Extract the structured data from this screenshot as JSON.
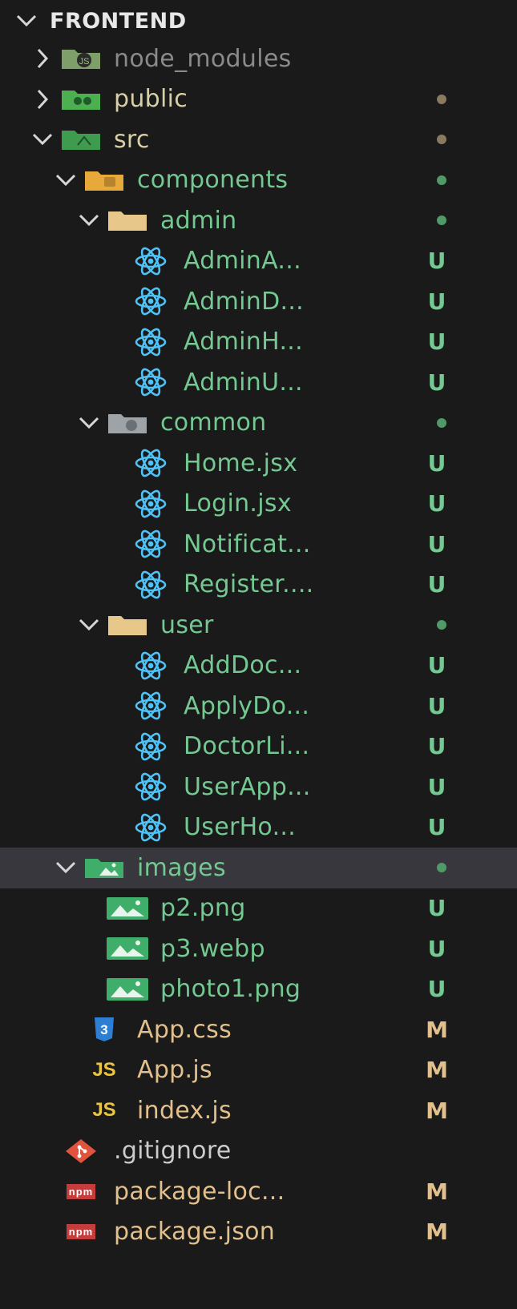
{
  "explorer": {
    "root": {
      "label": "FRONTEND"
    },
    "items": [
      {
        "label": "node_modules",
        "type": "folder",
        "icon": "js-folder-icon",
        "chevron": "right",
        "badge": "",
        "dot": "",
        "color": "#8a8a8a",
        "iconColor": "#7e9e6a",
        "depth": 1
      },
      {
        "label": "public",
        "type": "folder",
        "icon": "public-folder-icon",
        "chevron": "right",
        "badge": "",
        "dot": "#8a7a60",
        "color": "#d8cfa6",
        "iconColor": "#4caf50",
        "depth": 1
      },
      {
        "label": "src",
        "type": "folder",
        "icon": "src-folder-icon",
        "chevron": "down",
        "badge": "",
        "dot": "#8a7a60",
        "color": "#d8cfa6",
        "iconColor": "#3f9b4e",
        "depth": 1
      },
      {
        "label": "components",
        "type": "folder",
        "icon": "components-folder-icon",
        "chevron": "down",
        "badge": "",
        "dot": "#4f9a67",
        "color": "#73c991",
        "iconColor": "#e8a93b",
        "depth": 2
      },
      {
        "label": "admin",
        "type": "folder",
        "icon": "folder-icon",
        "chevron": "down",
        "badge": "",
        "dot": "#4f9a67",
        "color": "#73c991",
        "iconColor": "#e7c78a",
        "depth": 3
      },
      {
        "label": "AdminA...",
        "type": "react",
        "icon": "react-icon",
        "chevron": "",
        "badge": "U",
        "dot": "",
        "color": "#73c991",
        "iconColor": "#4fc3f7",
        "depth": 4
      },
      {
        "label": "AdminD...",
        "type": "react",
        "icon": "react-icon",
        "chevron": "",
        "badge": "U",
        "dot": "",
        "color": "#73c991",
        "iconColor": "#4fc3f7",
        "depth": 4
      },
      {
        "label": "AdminH...",
        "type": "react",
        "icon": "react-icon",
        "chevron": "",
        "badge": "U",
        "dot": "",
        "color": "#73c991",
        "iconColor": "#4fc3f7",
        "depth": 4
      },
      {
        "label": "AdminU...",
        "type": "react",
        "icon": "react-icon",
        "chevron": "",
        "badge": "U",
        "dot": "",
        "color": "#73c991",
        "iconColor": "#4fc3f7",
        "depth": 4
      },
      {
        "label": "common",
        "type": "folder",
        "icon": "common-folder-icon",
        "chevron": "down",
        "badge": "",
        "dot": "#4f9a67",
        "color": "#73c991",
        "iconColor": "#9ea3a8",
        "depth": 3
      },
      {
        "label": "Home.jsx",
        "type": "react",
        "icon": "react-icon",
        "chevron": "",
        "badge": "U",
        "dot": "",
        "color": "#73c991",
        "iconColor": "#4fc3f7",
        "depth": 4
      },
      {
        "label": "Login.jsx",
        "type": "react",
        "icon": "react-icon",
        "chevron": "",
        "badge": "U",
        "dot": "",
        "color": "#73c991",
        "iconColor": "#4fc3f7",
        "depth": 4
      },
      {
        "label": "Notificat...",
        "type": "react",
        "icon": "react-icon",
        "chevron": "",
        "badge": "U",
        "dot": "",
        "color": "#73c991",
        "iconColor": "#4fc3f7",
        "depth": 4
      },
      {
        "label": "Register....",
        "type": "react",
        "icon": "react-icon",
        "chevron": "",
        "badge": "U",
        "dot": "",
        "color": "#73c991",
        "iconColor": "#4fc3f7",
        "depth": 4
      },
      {
        "label": "user",
        "type": "folder",
        "icon": "folder-icon",
        "chevron": "down",
        "badge": "",
        "dot": "#4f9a67",
        "color": "#73c991",
        "iconColor": "#e7c78a",
        "depth": 3
      },
      {
        "label": "AddDoc...",
        "type": "react",
        "icon": "react-icon",
        "chevron": "",
        "badge": "U",
        "dot": "",
        "color": "#73c991",
        "iconColor": "#4fc3f7",
        "depth": 4
      },
      {
        "label": "ApplyDo...",
        "type": "react",
        "icon": "react-icon",
        "chevron": "",
        "badge": "U",
        "dot": "",
        "color": "#73c991",
        "iconColor": "#4fc3f7",
        "depth": 4
      },
      {
        "label": "DoctorLi...",
        "type": "react",
        "icon": "react-icon",
        "chevron": "",
        "badge": "U",
        "dot": "",
        "color": "#73c991",
        "iconColor": "#4fc3f7",
        "depth": 4
      },
      {
        "label": "UserApp...",
        "type": "react",
        "icon": "react-icon",
        "chevron": "",
        "badge": "U",
        "dot": "",
        "color": "#73c991",
        "iconColor": "#4fc3f7",
        "depth": 4
      },
      {
        "label": "UserHo...",
        "type": "react",
        "icon": "react-icon",
        "chevron": "",
        "badge": "U",
        "dot": "",
        "color": "#73c991",
        "iconColor": "#4fc3f7",
        "depth": 4
      },
      {
        "label": "images",
        "type": "folder",
        "icon": "images-folder-icon",
        "chevron": "down",
        "badge": "",
        "dot": "#4f9a67",
        "color": "#73c991",
        "iconColor": "#3fae6a",
        "depth": 2,
        "selected": true
      },
      {
        "label": "p2.png",
        "type": "image",
        "icon": "image-icon",
        "chevron": "",
        "badge": "U",
        "dot": "",
        "color": "#73c991",
        "iconColor": "#3fae6a",
        "depth": 3
      },
      {
        "label": "p3.webp",
        "type": "image",
        "icon": "image-icon",
        "chevron": "",
        "badge": "U",
        "dot": "",
        "color": "#73c991",
        "iconColor": "#3fae6a",
        "depth": 3
      },
      {
        "label": "photo1.png",
        "type": "image",
        "icon": "image-icon",
        "chevron": "",
        "badge": "U",
        "dot": "",
        "color": "#73c991",
        "iconColor": "#3fae6a",
        "depth": 3
      },
      {
        "label": "App.css",
        "type": "css",
        "icon": "css-icon",
        "chevron": "",
        "badge": "M",
        "dot": "",
        "color": "#e2c08d",
        "iconColor": "#2d7fd3",
        "depth": 2
      },
      {
        "label": "App.js",
        "type": "js",
        "icon": "js-icon",
        "chevron": "",
        "badge": "M",
        "dot": "",
        "color": "#e2c08d",
        "iconColor": "#e8c547",
        "depth": 2
      },
      {
        "label": "index.js",
        "type": "js",
        "icon": "js-icon",
        "chevron": "",
        "badge": "M",
        "dot": "",
        "color": "#e2c08d",
        "iconColor": "#e8c547",
        "depth": 2
      },
      {
        "label": ".gitignore",
        "type": "git",
        "icon": "git-icon",
        "chevron": "",
        "badge": "",
        "dot": "",
        "color": "#cccccc",
        "iconColor": "#e0533c",
        "depth": 1
      },
      {
        "label": "package-loc...",
        "type": "npm",
        "icon": "npm-icon",
        "chevron": "",
        "badge": "M",
        "dot": "",
        "color": "#e2c08d",
        "iconColor": "#c43c3c",
        "depth": 1
      },
      {
        "label": "package.json",
        "type": "npm",
        "icon": "npm-icon",
        "chevron": "",
        "badge": "M",
        "dot": "",
        "color": "#e2c08d",
        "iconColor": "#c43c3c",
        "depth": 1
      }
    ]
  }
}
